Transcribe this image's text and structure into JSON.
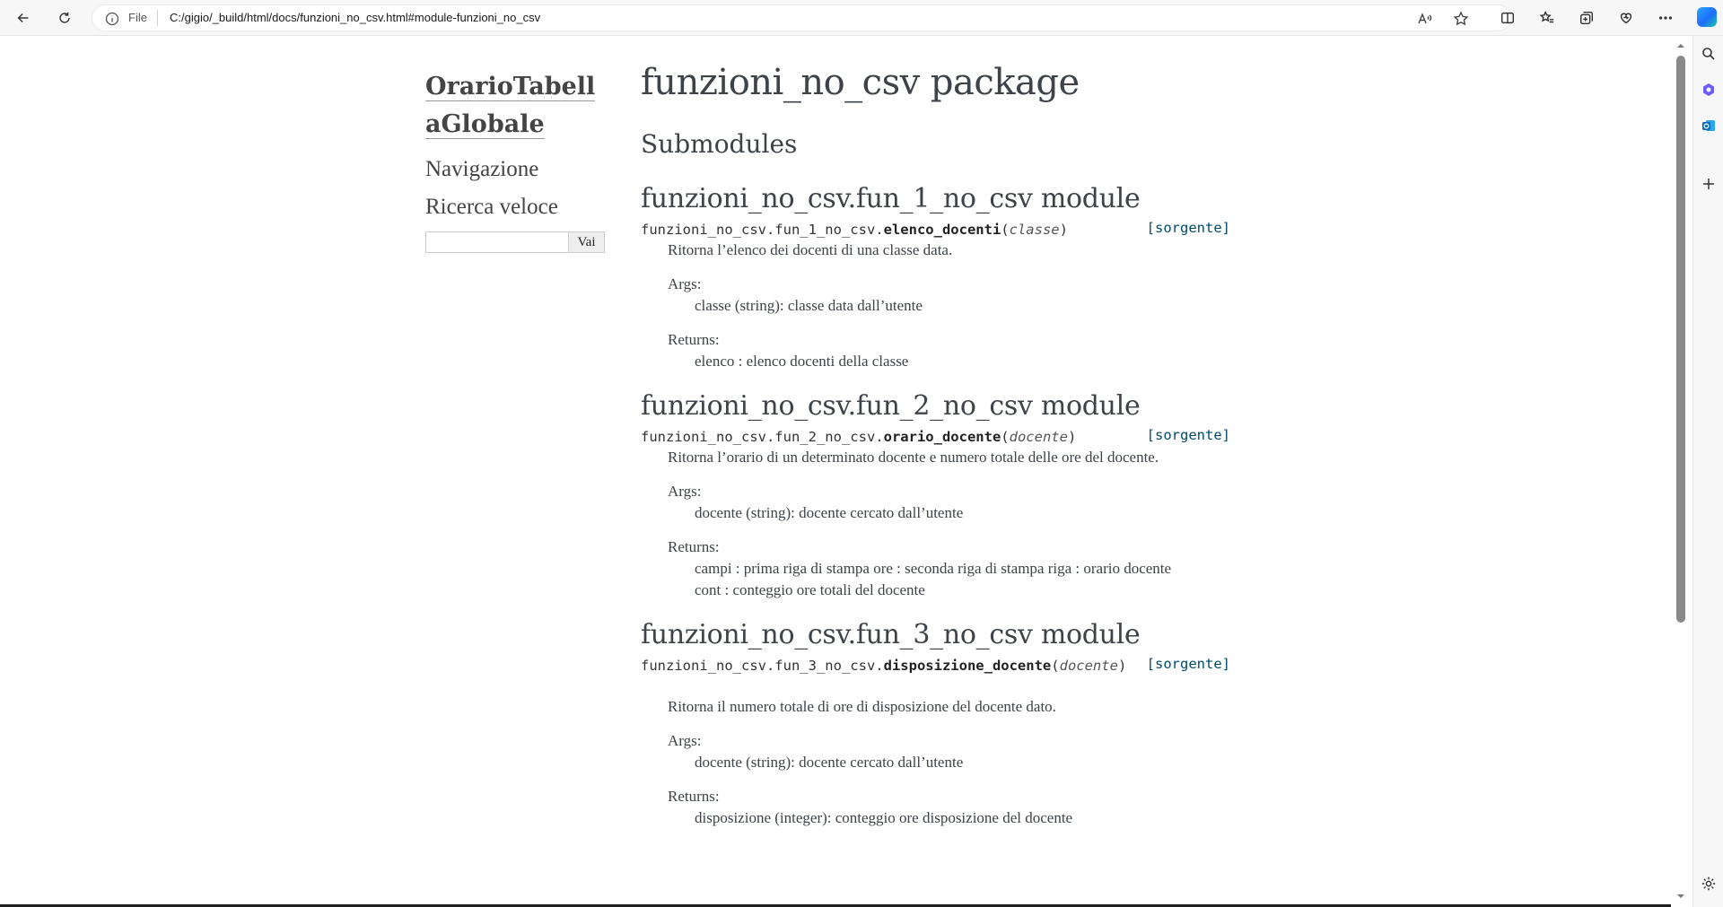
{
  "browser": {
    "address_scheme": "File",
    "address_url": "C:/gigio/_build/html/docs/funzioni_no_csv.html#module-funzioni_no_csv"
  },
  "sidebar": {
    "logo_line1": "OrarioTabell",
    "logo_line2": "aGlobale",
    "nav_heading": "Navigazione",
    "search_heading": "Ricerca veloce",
    "search_value": "",
    "search_button": "Vai"
  },
  "page": {
    "title": "funzioni_no_csv package",
    "submodules_heading": "Submodules",
    "source_link": "[sorgente]",
    "modules": [
      {
        "heading": "funzioni_no_csv.fun_1_no_csv module",
        "sig_prefix": "funzioni_no_csv.fun_1_no_csv.",
        "sig_name": "elenco_docenti",
        "sig_param": "classe",
        "description": "Ritorna l’elenco dei docenti di una classe data.",
        "args_label": "Args:",
        "args_lines": [
          "classe (string): classe data dall’utente"
        ],
        "returns_label": "Returns:",
        "returns_lines": [
          "elenco : elenco docenti della classe"
        ]
      },
      {
        "heading": "funzioni_no_csv.fun_2_no_csv module",
        "sig_prefix": "funzioni_no_csv.fun_2_no_csv.",
        "sig_name": "orario_docente",
        "sig_param": "docente",
        "description": "Ritorna l’orario di un determinato docente e numero totale delle ore del docente.",
        "args_label": "Args:",
        "args_lines": [
          "docente (string): docente cercato dall’utente"
        ],
        "returns_label": "Returns:",
        "returns_lines": [
          "campi : prima riga di stampa ore : seconda riga di stampa riga : orario docente",
          "cont : conteggio ore totali del docente"
        ]
      },
      {
        "heading": "funzioni_no_csv.fun_3_no_csv module",
        "sig_prefix": "funzioni_no_csv.fun_3_no_csv.",
        "sig_name": "disposizione_docente",
        "sig_param": "docente",
        "description": "Ritorna il numero totale di ore di disposizione del docente dato.",
        "args_label": "Args:",
        "args_lines": [
          "docente (string): docente cercato dall’utente"
        ],
        "returns_label": "Returns:",
        "returns_lines": [
          "disposizione (integer): conteggio ore disposizione del docente"
        ]
      }
    ]
  }
}
